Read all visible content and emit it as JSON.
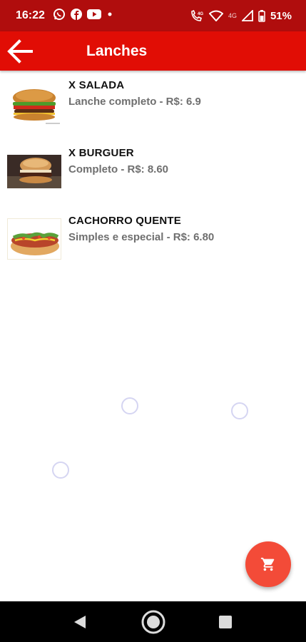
{
  "status_bar": {
    "time": "16:22",
    "battery": "51%",
    "net_label": "4G",
    "left_icons": [
      "whatsapp-icon",
      "facebook-icon",
      "youtube-icon",
      "dot-icon"
    ],
    "right_icons": [
      "volte-call-icon",
      "wifi-icon",
      "signal-icon",
      "battery-icon"
    ]
  },
  "app_bar": {
    "title": "Lanches",
    "back_icon": "arrow-back-icon",
    "color": "#e10d05"
  },
  "items": [
    {
      "title": "X SALADA",
      "description": "Lanche completo - R$: 6.9",
      "image": "burger-salad-image"
    },
    {
      "title": "X BURGUER",
      "description": "Completo - R$: 8.60",
      "image": "burger-image"
    },
    {
      "title": "CACHORRO QUENTE",
      "description": "Simples e especial - R$: 6.80",
      "image": "hotdog-image"
    }
  ],
  "fab": {
    "icon": "cart-icon",
    "color": "#f34b38"
  },
  "nav_bar": {
    "buttons": [
      "back-triangle-icon",
      "home-circle-icon",
      "recents-square-icon"
    ]
  }
}
